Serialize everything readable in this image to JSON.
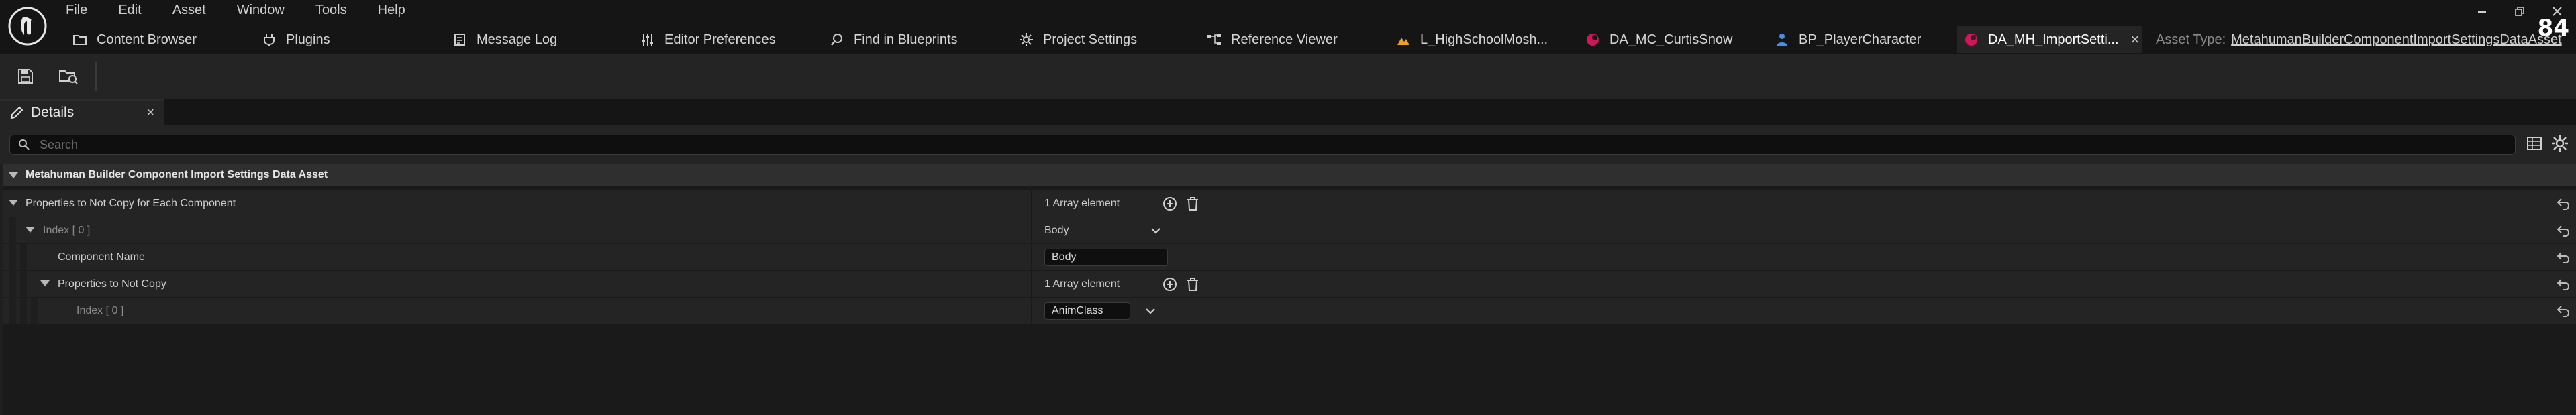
{
  "menu": [
    "File",
    "Edit",
    "Asset",
    "Window",
    "Tools",
    "Help"
  ],
  "fps": "84",
  "tabs": [
    {
      "label": "Content Browser",
      "icon": "folder-icon"
    },
    {
      "label": "Plugins",
      "icon": "plug-icon"
    },
    {
      "label": "Message Log",
      "icon": "log-icon"
    },
    {
      "label": "Editor Preferences",
      "icon": "sliders-icon"
    },
    {
      "label": "Find in Blueprints",
      "icon": "search-icon"
    },
    {
      "label": "Project Settings",
      "icon": "gear-icon"
    },
    {
      "label": "Reference Viewer",
      "icon": "graph-icon"
    },
    {
      "label": "L_HighSchoolMosh...",
      "icon": "level-icon"
    },
    {
      "label": "DA_MC_CurtisSnow",
      "icon": "data-asset-icon"
    },
    {
      "label": "BP_PlayerCharacter",
      "icon": "character-icon"
    },
    {
      "label": "DA_MH_ImportSetti...",
      "icon": "data-asset-icon"
    }
  ],
  "asset_type": {
    "label": "Asset Type:",
    "value": "MetahumanBuilderComponentImportSettingsDataAsset"
  },
  "details": {
    "title": "Details",
    "close": "×"
  },
  "search": {
    "placeholder": "Search"
  },
  "category": "Metahuman Builder Component Import Settings Data Asset",
  "rows": [
    {
      "label": "Properties to Not Copy for Each Component",
      "value": "1 Array element"
    },
    {
      "label": "Index [ 0 ]",
      "value": "Body"
    },
    {
      "label": "Component Name",
      "value": "Body"
    },
    {
      "label": "Properties to Not Copy",
      "value": "1 Array element"
    },
    {
      "label": "Index [ 0 ]",
      "value": "AnimClass"
    }
  ],
  "colors": {
    "accent_tab": "#d4145a",
    "background": "#151515",
    "panel": "#242424"
  }
}
